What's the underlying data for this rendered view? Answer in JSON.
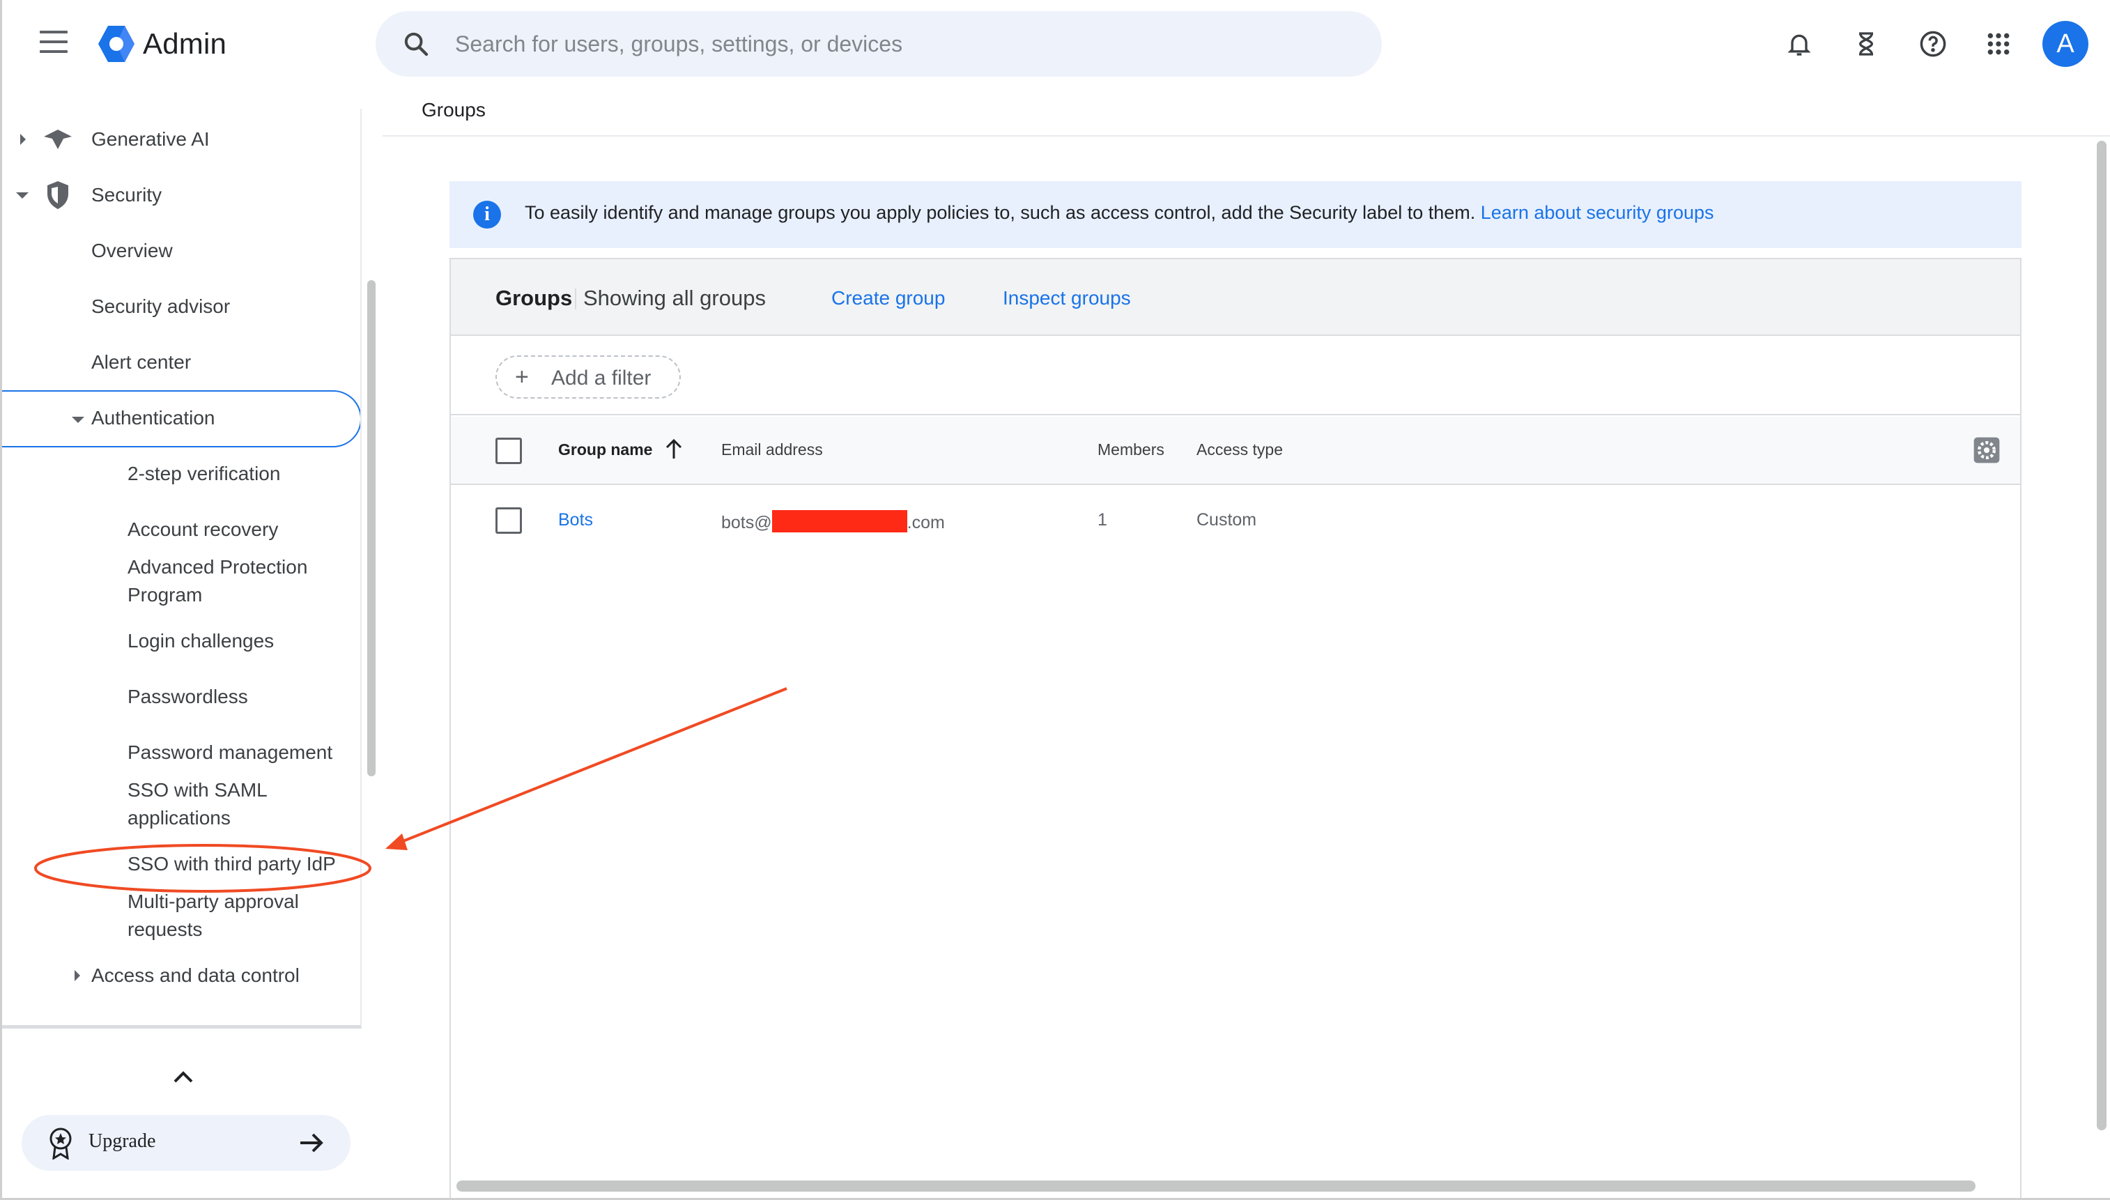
{
  "app": {
    "name": "Admin"
  },
  "search": {
    "placeholder": "Search for users, groups, settings, or devices"
  },
  "topbar": {
    "icons": [
      "notifications-bell-icon",
      "hourglass-icon",
      "help-icon",
      "apps-grid-icon"
    ],
    "avatar_letter": "A",
    "accent_color": "#1a73e8"
  },
  "sidebar": {
    "items": {
      "generative_ai": "Generative AI",
      "security": "Security",
      "overview": "Overview",
      "security_advisor": "Security advisor",
      "alert_center": "Alert center",
      "authentication": "Authentication",
      "two_step": "2-step verification",
      "account_recovery": "Account recovery",
      "advanced_protection_1": "Advanced Protection",
      "advanced_protection_2": "Program",
      "login_challenges": "Login challenges",
      "passwordless": "Passwordless",
      "password_management": "Password management",
      "sso_saml_1": "SSO with SAML",
      "sso_saml_2": "applications",
      "sso_third_party": "SSO with third party IdP",
      "multi_party_1": "Multi-party approval",
      "multi_party_2": "requests",
      "access_data_control": "Access and data control"
    },
    "upgrade_label": "Upgrade"
  },
  "main": {
    "breadcrumb_title": "Groups",
    "banner": {
      "text": "To easily identify and manage groups you apply policies to, such as access control, add the Security label to them. ",
      "link": "Learn about security groups"
    },
    "card": {
      "title": "Groups",
      "subtitle": "Showing all groups",
      "create_group": "Create group",
      "inspect_groups": "Inspect groups",
      "add_filter": "Add a filter"
    },
    "table": {
      "columns": {
        "group_name": "Group name",
        "email": "Email address",
        "members": "Members",
        "access_type": "Access type"
      },
      "sort": "ascending",
      "rows": [
        {
          "name": "Bots",
          "email_prefix": "bots@",
          "email_suffix": ".com",
          "members": "1",
          "access_type": "Custom"
        }
      ]
    }
  },
  "annotation": {
    "color": "#f04a23",
    "highlighted_item": "SSO with third party IdP"
  }
}
